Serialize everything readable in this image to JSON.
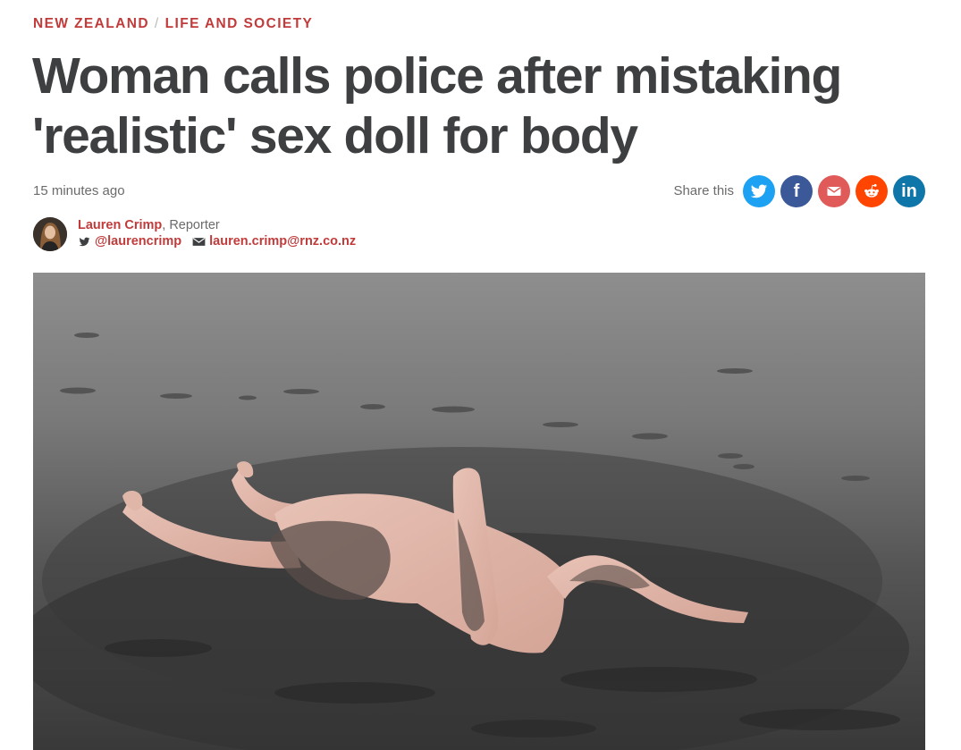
{
  "colors": {
    "accent": "#c13b3b",
    "headline": "#3d3f41",
    "muted": "#6b6b6b",
    "twitter": "#1da1f2",
    "facebook": "#3b5998",
    "email": "#e05a5a",
    "reddit": "#ff4500",
    "linkedin": "#0e76a8"
  },
  "breadcrumb": {
    "items": [
      {
        "label": "NEW ZEALAND"
      },
      {
        "label": "LIFE AND SOCIETY"
      }
    ],
    "separator": "/"
  },
  "article": {
    "headline": "Woman calls police after mistaking 'realistic' sex doll for body",
    "timestamp": "15 minutes ago"
  },
  "share": {
    "label": "Share this",
    "buttons": [
      {
        "name": "twitter",
        "icon": "twitter-bird-icon"
      },
      {
        "name": "facebook",
        "icon": "facebook-f-icon",
        "glyph": "f"
      },
      {
        "name": "email",
        "icon": "envelope-icon"
      },
      {
        "name": "reddit",
        "icon": "reddit-alien-icon"
      },
      {
        "name": "linkedin",
        "icon": "linkedin-in-icon",
        "glyph": "in"
      }
    ]
  },
  "author": {
    "name": "Lauren Crimp",
    "role_separator": ",",
    "role": "Reporter",
    "twitter_handle": "@laurencrimp",
    "email": "lauren.crimp@rnz.co.nz"
  },
  "hero_image": {
    "icon": "photo-doll-on-black-sand-beach"
  }
}
